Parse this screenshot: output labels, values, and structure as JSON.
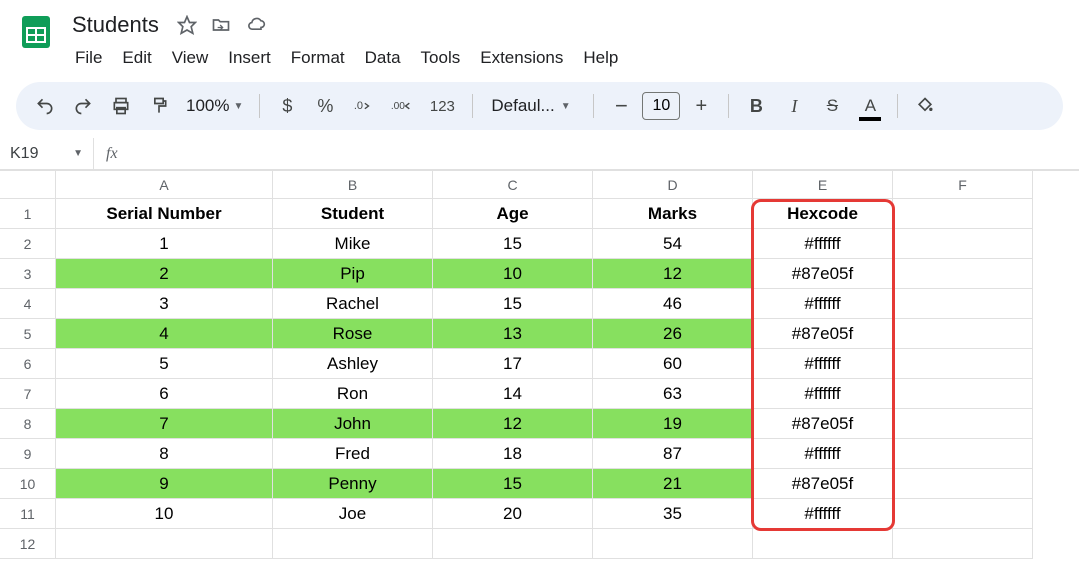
{
  "header": {
    "title": "Students",
    "menu": [
      "File",
      "Edit",
      "View",
      "Insert",
      "Format",
      "Data",
      "Tools",
      "Extensions",
      "Help"
    ]
  },
  "toolbar": {
    "zoom": "100%",
    "currency": "$",
    "percent": "%",
    "num_label": "123",
    "font": "Defaul...",
    "font_size": "10",
    "bold": "B",
    "italic": "I",
    "strike": "S",
    "text_color": "A"
  },
  "name_box": "K19",
  "fx_label": "fx",
  "columns": [
    "A",
    "B",
    "C",
    "D",
    "E",
    "F"
  ],
  "row_headers": [
    "1",
    "2",
    "3",
    "4",
    "5",
    "6",
    "7",
    "8",
    "9",
    "10",
    "11",
    "12"
  ],
  "table": {
    "headers": [
      "Serial Number",
      "Student",
      "Age",
      "Marks",
      "Hexcode"
    ],
    "rows": [
      {
        "serial": "1",
        "student": "Mike",
        "age": "15",
        "marks": "54",
        "hex": "#ffffff",
        "green": false
      },
      {
        "serial": "2",
        "student": "Pip",
        "age": "10",
        "marks": "12",
        "hex": "#87e05f",
        "green": true
      },
      {
        "serial": "3",
        "student": "Rachel",
        "age": "15",
        "marks": "46",
        "hex": "#ffffff",
        "green": false
      },
      {
        "serial": "4",
        "student": "Rose",
        "age": "13",
        "marks": "26",
        "hex": "#87e05f",
        "green": true
      },
      {
        "serial": "5",
        "student": "Ashley",
        "age": "17",
        "marks": "60",
        "hex": "#ffffff",
        "green": false
      },
      {
        "serial": "6",
        "student": "Ron",
        "age": "14",
        "marks": "63",
        "hex": "#ffffff",
        "green": false
      },
      {
        "serial": "7",
        "student": "John",
        "age": "12",
        "marks": "19",
        "hex": "#87e05f",
        "green": true
      },
      {
        "serial": "8",
        "student": "Fred",
        "age": "18",
        "marks": "87",
        "hex": "#ffffff",
        "green": false
      },
      {
        "serial": "9",
        "student": "Penny",
        "age": "15",
        "marks": "21",
        "hex": "#87e05f",
        "green": true
      },
      {
        "serial": "10",
        "student": "Joe",
        "age": "20",
        "marks": "35",
        "hex": "#ffffff",
        "green": false
      }
    ]
  }
}
